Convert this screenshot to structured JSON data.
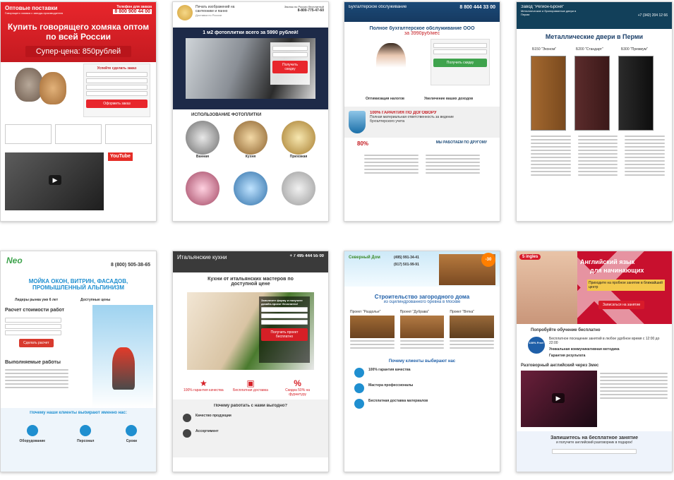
{
  "colors": {
    "red": "#e8262c",
    "dark_navy": "#1d2a48",
    "blue": "#1f8fd0",
    "green": "#4caf50",
    "orange": "#ff9800"
  },
  "cards": {
    "hamster": {
      "brand": "Оптовые поставки",
      "brand_sub": "Говорящего хомяка с завода-производителя",
      "phone_label": "Телефон для заказа",
      "phone": "8 800 900 44 00",
      "headline": "Купить говорящего хомяка оптом по всей России",
      "price": "Супер-цена: 850рублей",
      "form_title": "Успейте сделать заказ",
      "submit": "Оформить заказ",
      "video_badge": "YouTube"
    },
    "tiles": {
      "brand": "Печать изображений на сантехнике и панно",
      "delivery": "Доставка по России",
      "phone_label": "Звонок по России бесплатный",
      "phone": "8-800-775-47-60",
      "headline": "1 м2 фотоплитки всего за 5990 рублей!",
      "cta": "Получить скидку",
      "section": "ИСПОЛЬЗОВАНИЕ ФОТОПЛИТКИ",
      "uses": [
        "Ванная",
        "Кухня",
        "Прихожая"
      ]
    },
    "accounting": {
      "brand": "Бухгалтерское обслуживание",
      "phone": "8 800 444 33 00",
      "headline": "Полное бухгалтерское обслуживание ООО",
      "price": "за 3990руб/мес",
      "cta": "Получить скидку",
      "benefit1": "Оптимизация налогов",
      "benefit2": "Увеличение ваших доходов",
      "guarantee": "100% ГАРАНТИЯ ПО ДОГОВОРУ",
      "guarantee_sub": "Полная материальная ответственность за ведение бухгалтерского учета",
      "percent": "80%",
      "diff": "МЫ РАБОТАЕМ ПО ДРУГОМУ"
    },
    "doors": {
      "brand": "Завод \"Регион-Броня\"",
      "brand_sub": "Металлические и бронированные двери в Перми",
      "phone": "+7 (342) 204 12 66",
      "headline": "Металлические двери в Перми",
      "models": [
        "Б150 \"Эконом\"",
        "Б200 \"Стандарт\"",
        "Б300 \"Премиум\""
      ]
    },
    "windows": {
      "logo": "Neo",
      "phone": "8 (800) 505-38-65",
      "headline": "МОЙКА ОКОН, ВИТРИН, ФАСАДОВ, ПРОМЫШЛЕННЫЙ АЛЬПИНИЗМ",
      "leader": "Лидеры рынка уже 6 лет",
      "services": "Доступные цены",
      "calc": "Расчет стоимости работ",
      "submit": "Сделать расчет",
      "done": "Выполняемые работы",
      "why": "Почему наши клиенты выбирают именно нас:",
      "reasons": [
        "Оборудование",
        "Персонал",
        "Сроки"
      ]
    },
    "kitchens": {
      "brand": "Итальянские кухни",
      "phone": "+ 7 495 444 55 00",
      "headline": "Кухни от итальянских мастеров по доступной цене",
      "form_title": "Заполните форму и получите дизайн-проект бесплатно!",
      "submit": "Получить проект бесплатно",
      "features": [
        "100% гарантия качества",
        "Бесплатная доставка",
        "Скидка 50% на фурнитуру"
      ],
      "why": "Почему работать с нами выгодно?",
      "items": [
        "Качество продукции",
        "Ассортимент"
      ]
    },
    "houses": {
      "logo": "Северный Дом",
      "phone1": "(495) 991-34-41",
      "phone2": "(917) 501-99-91",
      "badge": "-30",
      "headline": "Строительство загородного дома",
      "sub": "из оцилиндрованного бревна в Москве",
      "projects": [
        "Проект \"Раздолье\"",
        "Проект \"Дубрава\"",
        "Проект \"Вятка\""
      ],
      "why": "Почему клиенты выбирают нас",
      "points": [
        "100% гарантия качества",
        "Мастера профессионалы",
        "Бесплатная доставка материалов"
      ]
    },
    "english": {
      "logo": "5 ingles",
      "headline1": "Английский язык",
      "headline2": "для начинающих",
      "sub": "Приходите на пробное занятие в ближайший центр",
      "cta": "Записаться на занятие",
      "trial": "Попробуйте обучение бесплатно",
      "free_badge": "100% Free!",
      "trial_p1": "Бесплатное посещение занятий в любое удобное время с 12:00 до 22:00",
      "trial_p2": "Уникальная коммуникативная методика",
      "trial_p3": "Гарантия результата",
      "video_title": "Разговорный английский через 3мес",
      "signup": "Запишитесь на бесплатное занятие",
      "signup_sub": "и получите английский разговорник в подарок!"
    }
  }
}
